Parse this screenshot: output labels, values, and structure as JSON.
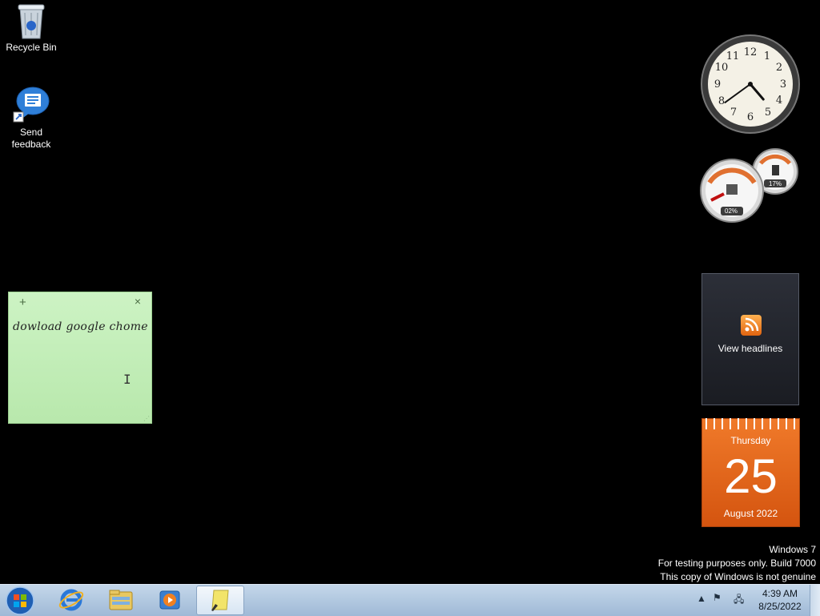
{
  "desktop": {
    "icons": [
      {
        "label": "Recycle Bin"
      },
      {
        "label_line1": "Send",
        "label_line2": "feedback"
      }
    ]
  },
  "sticky_note": {
    "text": "dowload google chome",
    "add_symbol": "+",
    "close_symbol": "×"
  },
  "gadgets": {
    "clock": {
      "hour": 4,
      "minute": 39
    },
    "cpu_meter": {
      "cpu_percent": "02%",
      "memory_percent": "17%"
    },
    "feed": {
      "label": "View headlines"
    },
    "calendar": {
      "weekday": "Thursday",
      "day": "25",
      "month_year": "August 2022",
      "accent": "#e8661b"
    }
  },
  "watermark": {
    "line1": "Windows 7",
    "line2": "For testing purposes only. Build 7000",
    "line3": "This copy of Windows is not genuine"
  },
  "taskbar": {
    "start_icon": "windows-orb-icon",
    "pinned": [
      "internet-explorer-icon",
      "windows-explorer-icon",
      "media-player-icon",
      "sticky-notes-icon"
    ],
    "time": "4:39 AM",
    "date": "8/25/2022",
    "tray_icons": [
      "show-hidden-icons",
      "action-center-flag-icon",
      "network-icon"
    ]
  }
}
